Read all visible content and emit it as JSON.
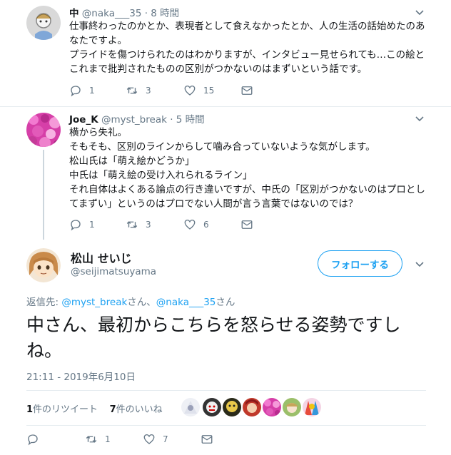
{
  "tweets": [
    {
      "name": "中",
      "handle": "@naka___35",
      "time": "· 8 時間",
      "text": "仕事終わったのかとか、表現者として食えなかったとか、人の生活の話始めたのあなたですよ。\nプライドを傷つけられたのはわかりますが、インタビュー見せられても…この絵とこれまで批判されたものの区別がつかないのはまずいという話です。",
      "replies": "1",
      "retweets": "3",
      "likes": "15"
    },
    {
      "name": "Joe_K",
      "handle": "@myst_break",
      "time": "· 5 時間",
      "text": "横から失礼。\nそもそも、区別のラインからして噛み合っていないような気がします。\n松山氏は「萌え絵かどうか」\n中氏は「萌え絵の受け入れられるライン」\nそれ自体はよくある論点の行き違いですが、中氏の「区別がつかないのはプロとしてまずい」というのはプロでない人間が言う言葉ではないのでは？",
      "replies": "1",
      "retweets": "3",
      "likes": "6"
    }
  ],
  "main_tweet": {
    "name": "松山 せいじ",
    "handle": "@seijimatsuyama",
    "follow_label": "フォローする",
    "reply_prefix": "返信先: ",
    "reply_user1": "@myst_break",
    "reply_mid": "さん、",
    "reply_user2": "@naka___35",
    "reply_suffix": "さん",
    "text": "中さん、最初からこちらを怒らせる姿勢ですしね。",
    "timestamp": "21:11 - 2019年6月10日",
    "retweet_count": "1",
    "retweet_label": "件のリツイート",
    "like_count": "7",
    "like_label": "件のいいね",
    "replies": "",
    "retweets": "1",
    "likes": "7"
  },
  "icons": {
    "reply": "reply-icon",
    "retweet": "retweet-icon",
    "like": "heart-icon",
    "message": "envelope-icon",
    "more": "chevron-down-icon"
  },
  "colors": {
    "accent": "#1da1f2",
    "secondary_text": "#657786",
    "divider": "#e6ecf0"
  }
}
